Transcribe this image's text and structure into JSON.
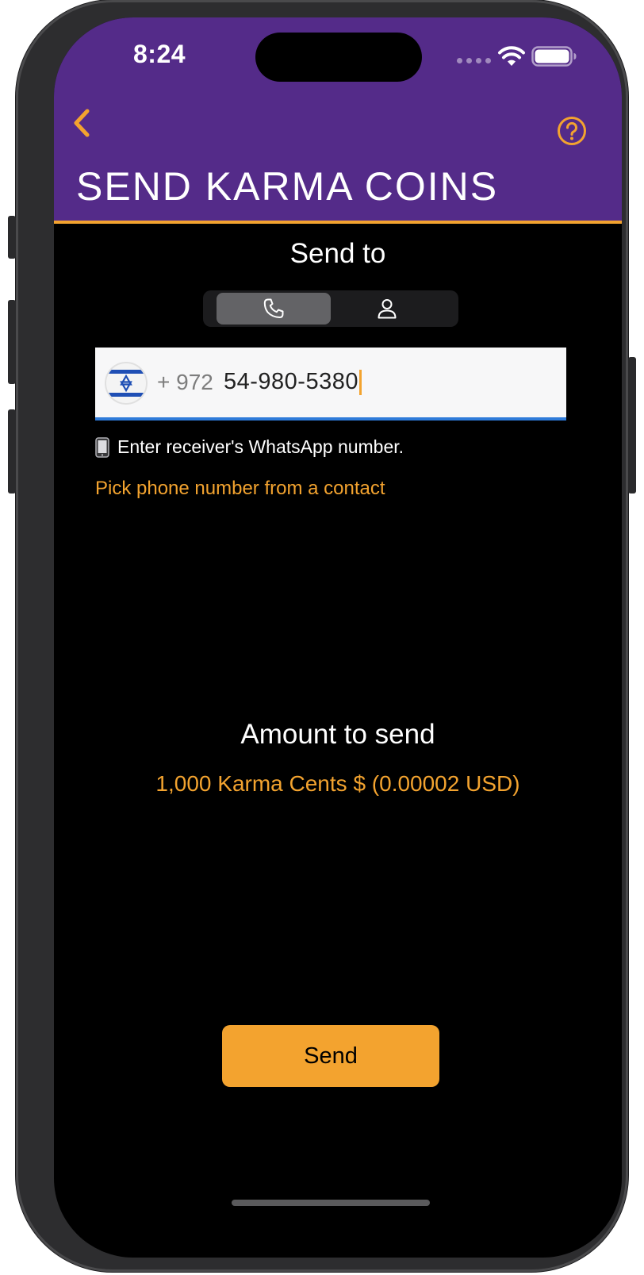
{
  "status_bar": {
    "time": "8:24",
    "signal_icon": "signal-dots-icon",
    "wifi_icon": "wifi-icon",
    "battery_icon": "battery-icon"
  },
  "header": {
    "title": "SEND KARMA COINS",
    "back_icon": "chevron-left-icon",
    "help_icon": "question-circle-icon",
    "background_color": "#542b89",
    "accent_color": "#f3a32f"
  },
  "send_to": {
    "label": "Send to",
    "segments": [
      {
        "icon": "phone-icon",
        "selected": true
      },
      {
        "icon": "person-icon",
        "selected": false
      }
    ]
  },
  "phone_input": {
    "country_flag": "israel-flag-icon",
    "dial_code": "+ 972",
    "value": "54-980-5380",
    "underline_color": "#2f7bd9"
  },
  "hint": {
    "emoji": "📱",
    "text": "Enter receiver's WhatsApp number."
  },
  "contact_link": {
    "label": "Pick phone number from a contact"
  },
  "amount": {
    "label": "Amount to send",
    "value": "1,000 Karma Cents $ (0.00002 USD)"
  },
  "send_button": {
    "label": "Send",
    "color": "#f3a32f"
  }
}
